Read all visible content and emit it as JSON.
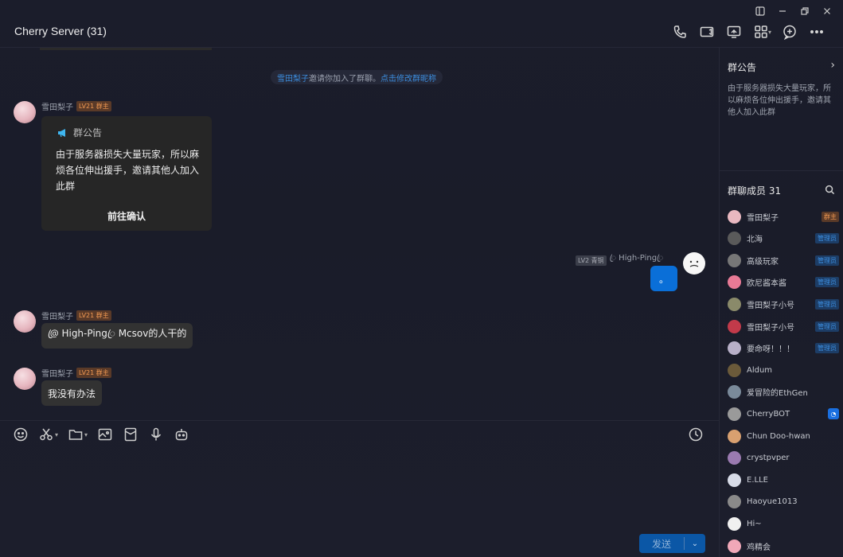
{
  "window": {
    "title": "Cherry Server (31)"
  },
  "chat": {
    "system_message": {
      "actor": "雪田梨子",
      "text": "邀请你加入了群聊。",
      "link": "点击修改群昵称"
    },
    "messages": [
      {
        "sender": "雪田梨子",
        "badge": "LV21 群主",
        "type": "notice_card",
        "card_title": "群公告",
        "card_body": "由于服务器损失大量玩家，所以麻烦各位伸出援手，邀请其他人加入此群",
        "card_button": "前往确认"
      },
      {
        "sender": "ꦿ High-Pingꦿ",
        "badge": "LV2 青铜",
        "type": "self",
        "text": "。"
      },
      {
        "sender": "雪田梨子",
        "badge": "LV21 群主",
        "type": "text",
        "text": "@ꦿ High-Pingꦿ Mcsov的人干的"
      },
      {
        "sender": "雪田梨子",
        "badge": "LV21 群主",
        "type": "text",
        "text": "我没有办法"
      }
    ]
  },
  "input": {
    "send_label": "发送"
  },
  "right_panel": {
    "notice_title": "群公告",
    "notice_text": "由于服务器损失大量玩家，所以麻烦各位伸出援手，邀请其他人加入此群",
    "members_title": "群聊成员 31",
    "members": [
      {
        "name": "雪田梨子",
        "badge": "群主",
        "badge_type": "owner",
        "color": "#e9b8c0"
      },
      {
        "name": "北海",
        "badge": "管理员",
        "badge_type": "admin",
        "color": "#5a5a5a"
      },
      {
        "name": "高级玩家",
        "badge": "管理员",
        "badge_type": "admin",
        "color": "#777777"
      },
      {
        "name": "欧尼酱本酱",
        "badge": "管理员",
        "badge_type": "admin",
        "color": "#e87a96"
      },
      {
        "name": "雪田梨子小号",
        "badge": "管理员",
        "badge_type": "admin",
        "color": "#8a8a6a"
      },
      {
        "name": "雪田梨子小号",
        "badge": "管理员",
        "badge_type": "admin",
        "color": "#c23a4a"
      },
      {
        "name": "要命呀！！！",
        "badge": "管理员",
        "badge_type": "admin",
        "color": "#b8b0c8"
      },
      {
        "name": "Aldum",
        "badge": "",
        "badge_type": "",
        "color": "#6b5a3a"
      },
      {
        "name": "爱冒险的EthGen",
        "badge": "",
        "badge_type": "",
        "color": "#7a8a9a"
      },
      {
        "name": "CherryBOT",
        "badge": "◔",
        "badge_type": "bot",
        "color": "#9a9a9a"
      },
      {
        "name": "Chun Doo-hwan",
        "badge": "",
        "badge_type": "",
        "color": "#d8a070"
      },
      {
        "name": "crystpvper",
        "badge": "",
        "badge_type": "",
        "color": "#9a7ab0"
      },
      {
        "name": "E.LLE",
        "badge": "",
        "badge_type": "",
        "color": "#d8dce8"
      },
      {
        "name": "Haoyue1013",
        "badge": "",
        "badge_type": "",
        "color": "#8a8a8a"
      },
      {
        "name": "Hi~",
        "badge": "",
        "badge_type": "",
        "color": "#f0f0f0"
      },
      {
        "name": "鸡精会",
        "badge": "",
        "badge_type": "",
        "color": "#f0a8b8"
      }
    ]
  }
}
